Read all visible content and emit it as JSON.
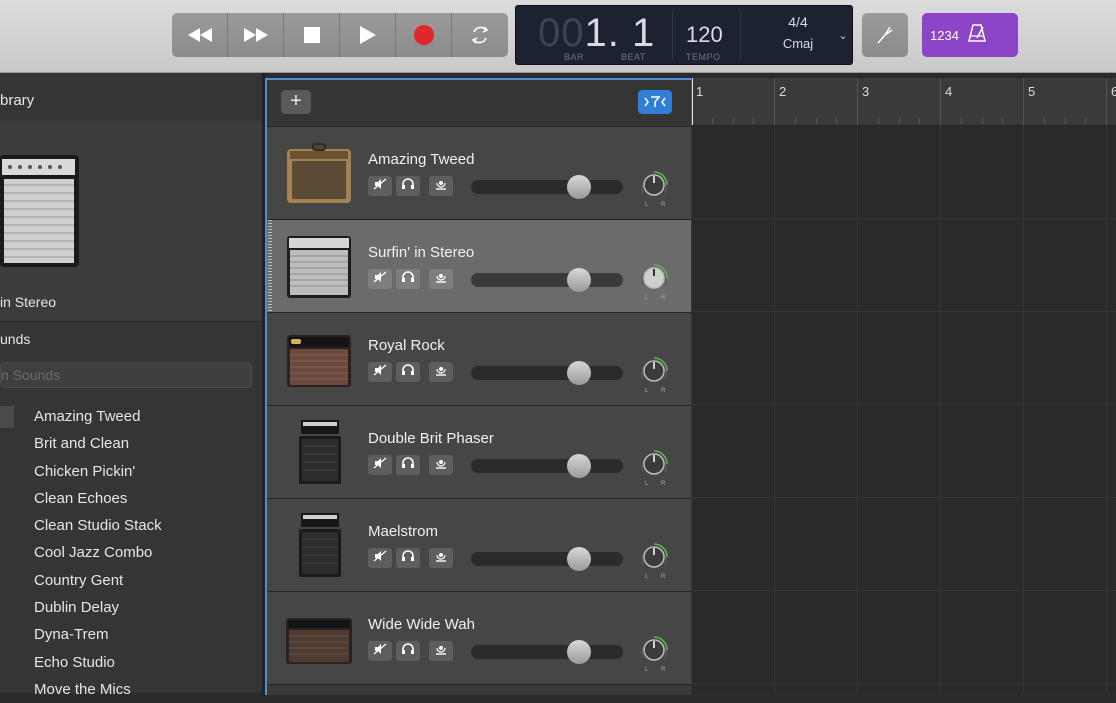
{
  "transport": {
    "buttons": [
      "rewind",
      "fast-forward",
      "stop",
      "play",
      "record",
      "cycle"
    ],
    "record_color": "#e0262b"
  },
  "lcd": {
    "position_dim": "00",
    "position_lit": "1. 1",
    "bar_label": "BAR",
    "beat_label": "BEAT",
    "tempo": "120",
    "tempo_label": "TEMPO",
    "time_signature": "4/4",
    "key": "Cmaj"
  },
  "count_in": {
    "label": "1234",
    "accent": "#8b45c6"
  },
  "library": {
    "title": "brary",
    "preview_name": "in Stereo",
    "section_title": "unds",
    "search_placeholder": "n Sounds",
    "items": [
      "Amazing Tweed",
      "Brit and Clean",
      "Chicken Pickin'",
      "Clean Echoes",
      "Clean Studio Stack",
      "Cool Jazz Combo",
      "Country Gent",
      "Dublin Delay",
      "Dyna-Trem",
      "Echo Studio",
      "Move the Mics"
    ]
  },
  "tracks": {
    "add_label": "+",
    "list": [
      {
        "name": "Amazing Tweed",
        "amp": "tweed",
        "selected": false
      },
      {
        "name": "Surfin' in Stereo",
        "amp": "silver",
        "selected": true
      },
      {
        "name": "Royal Rock",
        "amp": "vox",
        "selected": false
      },
      {
        "name": "Double Brit Phaser",
        "amp": "stack",
        "selected": false
      },
      {
        "name": "Maelstrom",
        "amp": "stack",
        "selected": false
      },
      {
        "name": "Wide Wide Wah",
        "amp": "wide",
        "selected": false
      }
    ],
    "pan_left": "L",
    "pan_right": "R"
  },
  "ruler": {
    "bars": [
      "1",
      "2",
      "3",
      "4",
      "5",
      "6"
    ]
  },
  "accent_blue": "#2f7fd6"
}
